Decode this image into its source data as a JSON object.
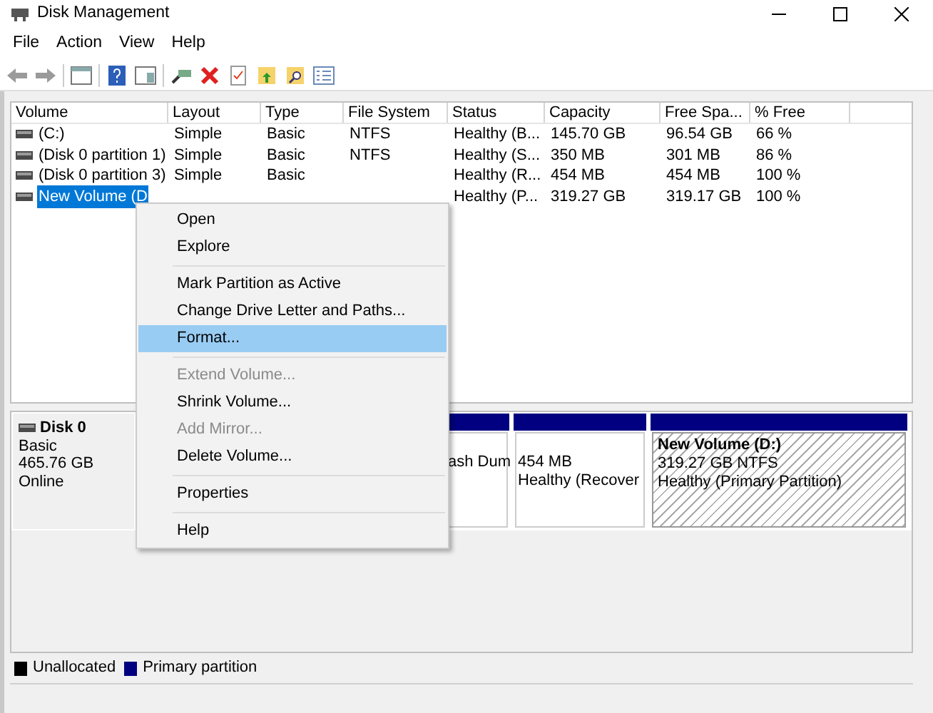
{
  "window": {
    "title": "Disk Management"
  },
  "menu": [
    "File",
    "Action",
    "View",
    "Help"
  ],
  "table": {
    "columns": [
      "Volume",
      "Layout",
      "Type",
      "File System",
      "Status",
      "Capacity",
      "Free Spa...",
      "% Free"
    ],
    "rows": [
      {
        "selected": false,
        "cells": [
          "(C:)",
          "Simple",
          "Basic",
          "NTFS",
          "Healthy (B...",
          "145.70 GB",
          "96.54 GB",
          "66 %"
        ]
      },
      {
        "selected": false,
        "cells": [
          "(Disk 0 partition 1)",
          "Simple",
          "Basic",
          "NTFS",
          "Healthy (S...",
          "350 MB",
          "301 MB",
          "86 %"
        ]
      },
      {
        "selected": false,
        "cells": [
          "(Disk 0 partition 3)",
          "Simple",
          "Basic",
          "",
          "Healthy (R...",
          "454 MB",
          "454 MB",
          "100 %"
        ]
      },
      {
        "selected": true,
        "cells": [
          "New Volume (D",
          "",
          "",
          "",
          "Healthy (P...",
          "319.27 GB",
          "319.17 GB",
          "100 %"
        ]
      }
    ]
  },
  "context_menu": [
    {
      "kind": "item",
      "label": "Open",
      "disabled": false,
      "selected": false
    },
    {
      "kind": "item",
      "label": "Explore",
      "disabled": false,
      "selected": false
    },
    {
      "kind": "separator"
    },
    {
      "kind": "item",
      "label": "Mark Partition as Active",
      "disabled": false,
      "selected": false
    },
    {
      "kind": "item",
      "label": "Change Drive Letter and Paths...",
      "disabled": false,
      "selected": false
    },
    {
      "kind": "item",
      "label": "Format...",
      "disabled": false,
      "selected": true
    },
    {
      "kind": "separator"
    },
    {
      "kind": "item",
      "label": "Extend Volume...",
      "disabled": true,
      "selected": false
    },
    {
      "kind": "item",
      "label": "Shrink Volume...",
      "disabled": false,
      "selected": false
    },
    {
      "kind": "item",
      "label": "Add Mirror...",
      "disabled": true,
      "selected": false
    },
    {
      "kind": "item",
      "label": "Delete Volume...",
      "disabled": false,
      "selected": false
    },
    {
      "kind": "separator"
    },
    {
      "kind": "item",
      "label": "Properties",
      "disabled": false,
      "selected": false
    },
    {
      "kind": "separator"
    },
    {
      "kind": "item",
      "label": "Help",
      "disabled": false,
      "selected": false
    }
  ],
  "disk": {
    "name": "Disk 0",
    "type": "Basic",
    "size": "465.76 GB",
    "status": "Online",
    "partitions": [
      {
        "lines": [
          "ash Dum"
        ],
        "hatched": false
      },
      {
        "lines": [
          "454 MB",
          "Healthy (Recover"
        ],
        "hatched": false
      },
      {
        "title": "New Volume  (D:)",
        "lines": [
          "319.27 GB NTFS",
          "Healthy (Primary Partition)"
        ],
        "hatched": true
      }
    ]
  },
  "legend": [
    {
      "label": "Unallocated",
      "color": "#000000"
    },
    {
      "label": "Primary partition",
      "color": "#000080"
    }
  ]
}
